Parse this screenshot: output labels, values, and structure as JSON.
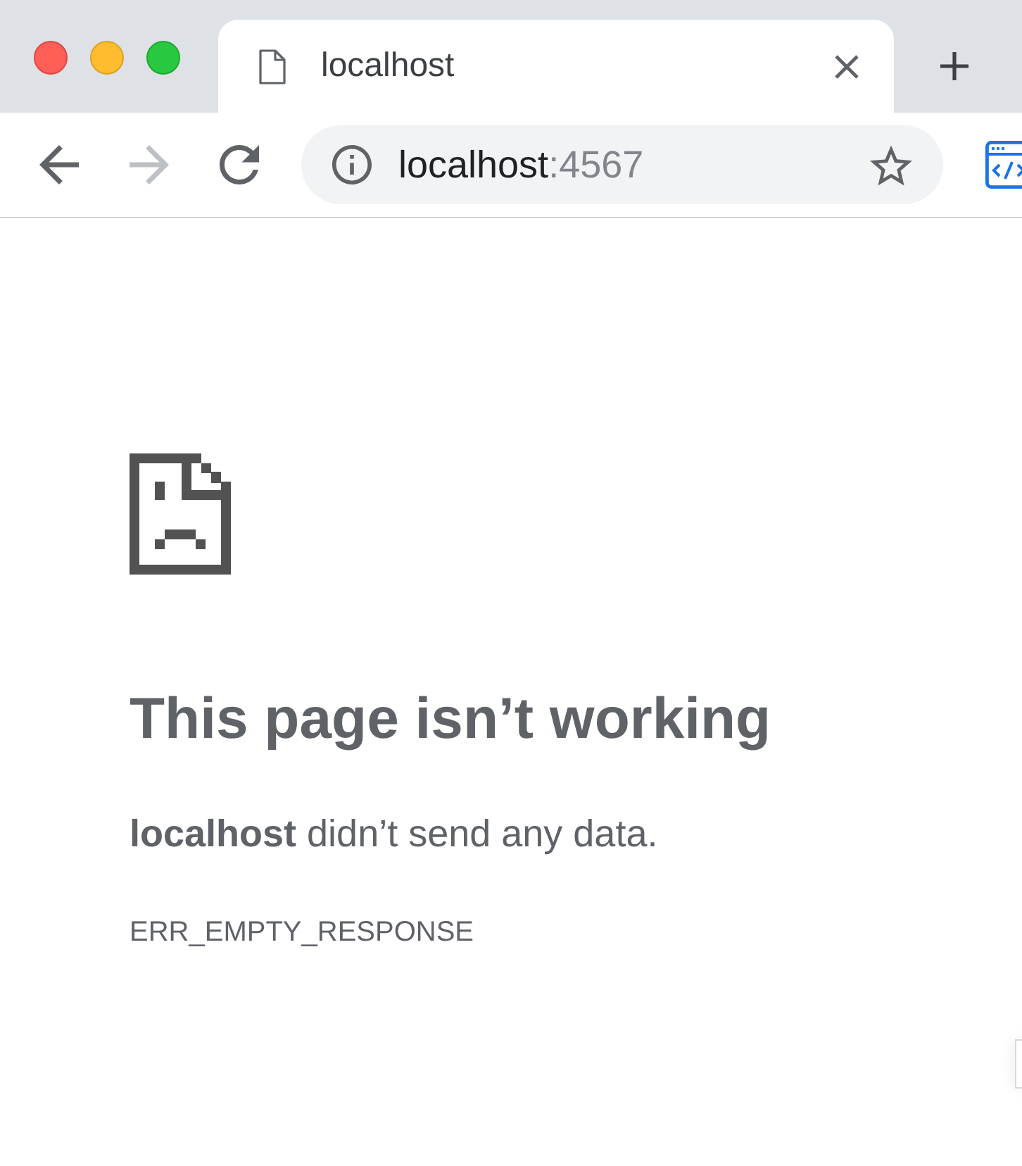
{
  "tabs": [
    {
      "title": "localhost",
      "selected": true
    }
  ],
  "toolbar_buttons": [
    {
      "kind": "back",
      "disabled": false
    },
    {
      "kind": "forward",
      "disabled": true
    },
    {
      "kind": "reload",
      "disabled": false
    }
  ],
  "address_bar": {
    "host": "localhost",
    "port": ":4567"
  },
  "page": {
    "heading": "This page isn’t working",
    "message": "**localhost** didn’t send any data.",
    "error_code": "ERR_EMPTY_RESPONSE"
  }
}
